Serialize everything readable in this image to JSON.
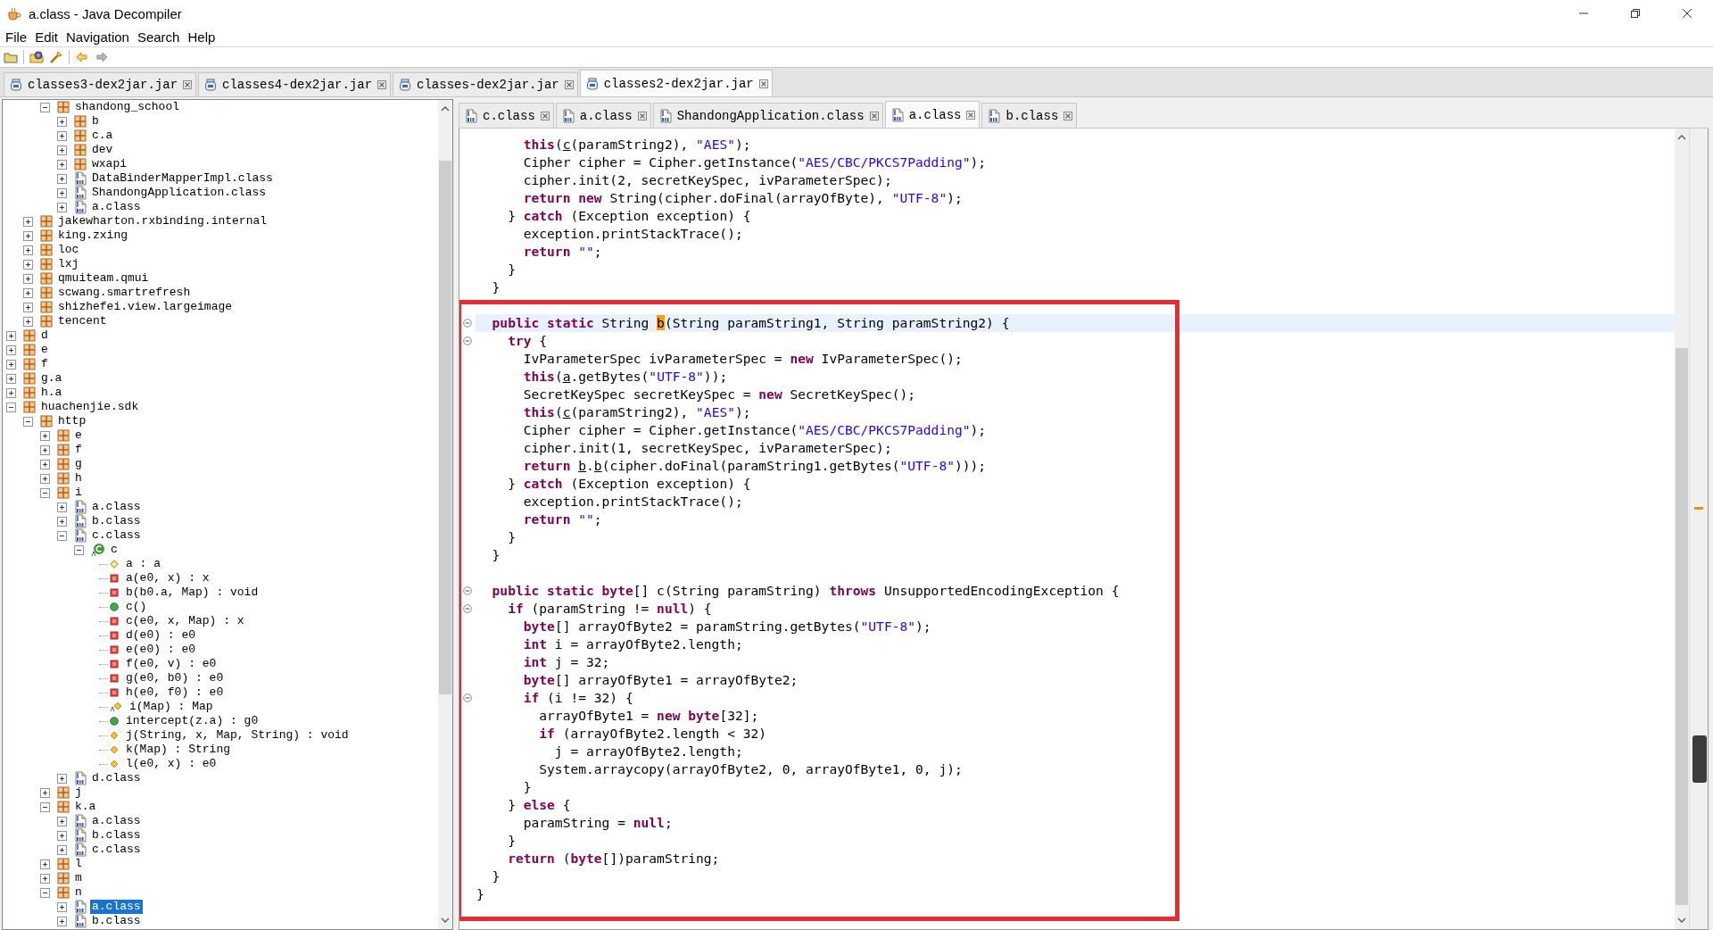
{
  "window": {
    "title": "a.class - Java Decompiler"
  },
  "menu": [
    "File",
    "Edit",
    "Navigation",
    "Search",
    "Help"
  ],
  "toolbar": {
    "back": {
      "disabled": false
    },
    "forward": {
      "disabled": true
    }
  },
  "jar_tabs": [
    {
      "label": "classes3-dex2jar.jar",
      "selected": false
    },
    {
      "label": "classes4-dex2jar.jar",
      "selected": false
    },
    {
      "label": "classes-dex2jar.jar",
      "selected": false
    },
    {
      "label": "classes2-dex2jar.jar",
      "selected": true
    }
  ],
  "tree": {
    "items": [
      {
        "children": [
          {
            "children": [
              {
                "label": "shandong_school",
                "kind": "package",
                "expanded": true,
                "selected": false,
                "children": [
                  {
                    "label": "b",
                    "kind": "package",
                    "expanded": false,
                    "selected": false
                  },
                  {
                    "label": "c.a",
                    "kind": "package",
                    "expanded": false,
                    "selected": false
                  },
                  {
                    "label": "dev",
                    "kind": "package",
                    "expanded": false,
                    "selected": false
                  },
                  {
                    "label": "wxapi",
                    "kind": "package",
                    "expanded": false,
                    "selected": false
                  },
                  {
                    "label": "DataBinderMapperImpl.class",
                    "kind": "classfile",
                    "expanded": false,
                    "selected": false
                  },
                  {
                    "label": "ShandongApplication.class",
                    "kind": "classfile",
                    "expanded": false,
                    "selected": false
                  },
                  {
                    "label": "a.class",
                    "kind": "classfile",
                    "expanded": false,
                    "selected": false
                  }
                ]
              }
            ]
          },
          {
            "label": "jakewharton.rxbinding.internal",
            "kind": "package",
            "expanded": false,
            "selected": false
          },
          {
            "label": "king.zxing",
            "kind": "package",
            "expanded": false,
            "selected": false
          },
          {
            "label": "loc",
            "kind": "package",
            "expanded": false,
            "selected": false
          },
          {
            "label": "lxj",
            "kind": "package",
            "expanded": false,
            "selected": false
          },
          {
            "label": "qmuiteam.qmui",
            "kind": "package",
            "expanded": false,
            "selected": false
          },
          {
            "label": "scwang.smartrefresh",
            "kind": "package",
            "expanded": false,
            "selected": false
          },
          {
            "label": "shizhefei.view.largeimage",
            "kind": "package",
            "expanded": false,
            "selected": false
          },
          {
            "label": "tencent",
            "kind": "package",
            "expanded": false,
            "selected": false
          }
        ]
      },
      {
        "label": "d",
        "kind": "package",
        "expanded": false,
        "selected": false
      },
      {
        "label": "e",
        "kind": "package",
        "expanded": false,
        "selected": false
      },
      {
        "label": "f",
        "kind": "package",
        "expanded": false,
        "selected": false
      },
      {
        "label": "g.a",
        "kind": "package",
        "expanded": false,
        "selected": false
      },
      {
        "label": "h.a",
        "kind": "package",
        "expanded": false,
        "selected": false
      },
      {
        "label": "huachenjie.sdk",
        "kind": "package",
        "expanded": true,
        "selected": false,
        "children": [
          {
            "label": "http",
            "kind": "package",
            "expanded": true,
            "selected": false,
            "children": [
              {
                "label": "e",
                "kind": "package",
                "expanded": false,
                "selected": false
              },
              {
                "label": "f",
                "kind": "package",
                "expanded": false,
                "selected": false
              },
              {
                "label": "g",
                "kind": "package",
                "expanded": false,
                "selected": false
              },
              {
                "label": "h",
                "kind": "package",
                "expanded": false,
                "selected": false
              },
              {
                "label": "i",
                "kind": "package",
                "expanded": true,
                "selected": false,
                "children": [
                  {
                    "label": "a.class",
                    "kind": "classfile",
                    "expanded": false,
                    "selected": false
                  },
                  {
                    "label": "b.class",
                    "kind": "classfile",
                    "expanded": false,
                    "selected": false
                  },
                  {
                    "label": "c.class",
                    "kind": "classfile",
                    "expanded": true,
                    "selected": false,
                    "children": [
                      {
                        "label": "c",
                        "kind": "class",
                        "expanded": true,
                        "selected": false,
                        "children": [
                          {
                            "label": "a : a",
                            "kind": "field",
                            "selected": false
                          },
                          {
                            "label": "a(e0, x) : x",
                            "kind": "private",
                            "selected": false
                          },
                          {
                            "label": "b(b0.a, Map) : void",
                            "kind": "private",
                            "selected": false
                          },
                          {
                            "label": "c()",
                            "kind": "public",
                            "selected": false
                          },
                          {
                            "label": "c(e0, x, Map) : x",
                            "kind": "private",
                            "selected": false
                          },
                          {
                            "label": "d(e0) : e0",
                            "kind": "private",
                            "selected": false
                          },
                          {
                            "label": "e(e0) : e0",
                            "kind": "private",
                            "selected": false
                          },
                          {
                            "label": "f(e0, v) : e0",
                            "kind": "private",
                            "selected": false
                          },
                          {
                            "label": "g(e0, b0) : e0",
                            "kind": "private",
                            "selected": false
                          },
                          {
                            "label": "h(e0, f0) : e0",
                            "kind": "private",
                            "selected": false
                          },
                          {
                            "label": "i(Map) : Map",
                            "kind": "abstract",
                            "selected": false
                          },
                          {
                            "label": "intercept(z.a) : g0",
                            "kind": "public",
                            "selected": false
                          },
                          {
                            "label": "j(String, x, Map, String) : void",
                            "kind": "default",
                            "selected": false
                          },
                          {
                            "label": "k(Map) : String",
                            "kind": "default",
                            "selected": false
                          },
                          {
                            "label": "l(e0, x) : e0",
                            "kind": "default",
                            "selected": false
                          }
                        ]
                      }
                    ]
                  },
                  {
                    "label": "d.class",
                    "kind": "classfile",
                    "expanded": false,
                    "selected": false
                  }
                ]
              },
              {
                "label": "j",
                "kind": "package",
                "expanded": false,
                "selected": false
              },
              {
                "label": "k.a",
                "kind": "package",
                "expanded": true,
                "selected": false,
                "children": [
                  {
                    "label": "a.class",
                    "kind": "classfile",
                    "expanded": false,
                    "selected": false
                  },
                  {
                    "label": "b.class",
                    "kind": "classfile",
                    "expanded": false,
                    "selected": false
                  },
                  {
                    "label": "c.class",
                    "kind": "classfile",
                    "expanded": false,
                    "selected": false
                  }
                ]
              },
              {
                "label": "l",
                "kind": "package",
                "expanded": false,
                "selected": false
              },
              {
                "label": "m",
                "kind": "package",
                "expanded": false,
                "selected": false
              },
              {
                "label": "n",
                "kind": "package",
                "expanded": true,
                "selected": false,
                "children": [
                  {
                    "label": "a.class",
                    "kind": "classfile",
                    "expanded": false,
                    "selected": true
                  },
                  {
                    "label": "b.class",
                    "kind": "classfile",
                    "expanded": false,
                    "selected": false
                  }
                ]
              }
            ]
          }
        ]
      }
    ]
  },
  "class_tabs": [
    {
      "label": "c.class",
      "selected": false
    },
    {
      "label": "a.class",
      "selected": false
    },
    {
      "label": "ShandongApplication.class",
      "selected": false
    },
    {
      "label": "a.class",
      "selected": true
    },
    {
      "label": "b.class",
      "selected": false
    }
  ],
  "code": {
    "blocks": [
      {
        "framed": false,
        "lines": [
          {
            "kind": "plain",
            "current": false,
            "tokens": [
              {
                "kind": "kw",
                "text": "      this"
              },
              {
                "kind": "p",
                "text": "("
              },
              {
                "kind": "u",
                "text": "c"
              },
              {
                "kind": "p",
                "text": "(paramString2), "
              },
              {
                "kind": "str",
                "text": "\"AES\""
              },
              {
                "kind": "p",
                "text": ");"
              }
            ]
          },
          {
            "kind": "plain",
            "current": false,
            "tokens": [
              {
                "kind": "p",
                "text": "      Cipher cipher = Cipher.getInstance("
              },
              {
                "kind": "str",
                "text": "\"AES/CBC/PKCS7Padding\""
              },
              {
                "kind": "p",
                "text": ");"
              }
            ]
          },
          {
            "kind": "plain",
            "current": false,
            "tokens": [
              {
                "kind": "p",
                "text": "      cipher.init(2, secretKeySpec, ivParameterSpec);"
              }
            ]
          },
          {
            "kind": "plain",
            "current": false,
            "tokens": [
              {
                "kind": "kw",
                "text": "      return new"
              },
              {
                "kind": "p",
                "text": " String(cipher.doFinal(arrayOfByte), "
              },
              {
                "kind": "str",
                "text": "\"UTF-8\""
              },
              {
                "kind": "p",
                "text": ");"
              }
            ]
          },
          {
            "kind": "plain",
            "current": false,
            "tokens": [
              {
                "kind": "p",
                "text": "    } "
              },
              {
                "kind": "kw",
                "text": "catch"
              },
              {
                "kind": "p",
                "text": " (Exception exception) {"
              }
            ]
          },
          {
            "kind": "plain",
            "current": false,
            "tokens": [
              {
                "kind": "p",
                "text": "      exception.printStackTrace();"
              }
            ]
          },
          {
            "kind": "plain",
            "current": false,
            "tokens": [
              {
                "kind": "kw",
                "text": "      return"
              },
              {
                "kind": "str",
                "text": " \"\""
              },
              {
                "kind": "p",
                "text": ";"
              }
            ]
          },
          {
            "kind": "plain",
            "current": false,
            "tokens": [
              {
                "kind": "p",
                "text": "    }"
              }
            ]
          },
          {
            "kind": "plain",
            "current": false,
            "tokens": [
              {
                "kind": "p",
                "text": "  }"
              }
            ]
          }
        ]
      },
      {
        "framed": true,
        "lines": [
          {
            "kind": "blank",
            "current": false
          },
          {
            "kind": "fold",
            "current": true,
            "tokens": [
              {
                "kind": "kw",
                "text": "  public static"
              },
              {
                "kind": "p",
                "text": " String "
              },
              {
                "kind": "mark",
                "text": "b"
              },
              {
                "kind": "p",
                "text": "(String paramString1, String paramString2) {"
              }
            ]
          },
          {
            "kind": "fold",
            "current": false,
            "tokens": [
              {
                "kind": "kw",
                "text": "    try"
              },
              {
                "kind": "p",
                "text": " {"
              }
            ]
          },
          {
            "kind": "plain",
            "current": false,
            "tokens": [
              {
                "kind": "p",
                "text": "      IvParameterSpec ivParameterSpec = "
              },
              {
                "kind": "kw",
                "text": "new"
              },
              {
                "kind": "p",
                "text": " IvParameterSpec();"
              }
            ]
          },
          {
            "kind": "plain",
            "current": false,
            "tokens": [
              {
                "kind": "kw",
                "text": "      this"
              },
              {
                "kind": "p",
                "text": "("
              },
              {
                "kind": "u",
                "text": "a"
              },
              {
                "kind": "p",
                "text": ".getBytes("
              },
              {
                "kind": "str",
                "text": "\"UTF-8\""
              },
              {
                "kind": "p",
                "text": "));"
              }
            ]
          },
          {
            "kind": "plain",
            "current": false,
            "tokens": [
              {
                "kind": "p",
                "text": "      SecretKeySpec secretKeySpec = "
              },
              {
                "kind": "kw",
                "text": "new"
              },
              {
                "kind": "p",
                "text": " SecretKeySpec();"
              }
            ]
          },
          {
            "kind": "plain",
            "current": false,
            "tokens": [
              {
                "kind": "kw",
                "text": "      this"
              },
              {
                "kind": "p",
                "text": "("
              },
              {
                "kind": "u",
                "text": "c"
              },
              {
                "kind": "p",
                "text": "(paramString2), "
              },
              {
                "kind": "str",
                "text": "\"AES\""
              },
              {
                "kind": "p",
                "text": ");"
              }
            ]
          },
          {
            "kind": "plain",
            "current": false,
            "tokens": [
              {
                "kind": "p",
                "text": "      Cipher cipher = Cipher.getInstance("
              },
              {
                "kind": "str",
                "text": "\"AES/CBC/PKCS7Padding\""
              },
              {
                "kind": "p",
                "text": ");"
              }
            ]
          },
          {
            "kind": "plain",
            "current": false,
            "tokens": [
              {
                "kind": "p",
                "text": "      cipher.init(1, secretKeySpec, ivParameterSpec);"
              }
            ]
          },
          {
            "kind": "plain",
            "current": false,
            "tokens": [
              {
                "kind": "kw",
                "text": "      return "
              },
              {
                "kind": "u",
                "text": "b"
              },
              {
                "kind": "p",
                "text": "."
              },
              {
                "kind": "u",
                "text": "b"
              },
              {
                "kind": "p",
                "text": "(cipher.doFinal(paramString1.getBytes("
              },
              {
                "kind": "str",
                "text": "\"UTF-8\""
              },
              {
                "kind": "p",
                "text": ")));"
              }
            ]
          },
          {
            "kind": "plain",
            "current": false,
            "tokens": [
              {
                "kind": "p",
                "text": "    } "
              },
              {
                "kind": "kw",
                "text": "catch"
              },
              {
                "kind": "p",
                "text": " (Exception exception) {"
              }
            ]
          },
          {
            "kind": "plain",
            "current": false,
            "tokens": [
              {
                "kind": "p",
                "text": "      exception.printStackTrace();"
              }
            ]
          },
          {
            "kind": "plain",
            "current": false,
            "tokens": [
              {
                "kind": "kw",
                "text": "      return"
              },
              {
                "kind": "str",
                "text": " \"\""
              },
              {
                "kind": "p",
                "text": ";"
              }
            ]
          },
          {
            "kind": "plain",
            "current": false,
            "tokens": [
              {
                "kind": "p",
                "text": "    }"
              }
            ]
          },
          {
            "kind": "plain",
            "current": false,
            "tokens": [
              {
                "kind": "p",
                "text": "  }"
              }
            ]
          },
          {
            "kind": "blank",
            "current": false
          },
          {
            "kind": "fold",
            "current": false,
            "tokens": [
              {
                "kind": "kw",
                "text": "  public static byte"
              },
              {
                "kind": "p",
                "text": "[] c(String paramString) "
              },
              {
                "kind": "kw",
                "text": "throws"
              },
              {
                "kind": "p",
                "text": " UnsupportedEncodingException {"
              }
            ]
          },
          {
            "kind": "fold",
            "current": false,
            "tokens": [
              {
                "kind": "kw",
                "text": "    if"
              },
              {
                "kind": "p",
                "text": " (paramString != "
              },
              {
                "kind": "kw",
                "text": "null"
              },
              {
                "kind": "p",
                "text": ") {"
              }
            ]
          },
          {
            "kind": "plain",
            "current": false,
            "tokens": [
              {
                "kind": "kw",
                "text": "      byte"
              },
              {
                "kind": "p",
                "text": "[] arrayOfByte2 = paramString.getBytes("
              },
              {
                "kind": "str",
                "text": "\"UTF-8\""
              },
              {
                "kind": "p",
                "text": ");"
              }
            ]
          },
          {
            "kind": "plain",
            "current": false,
            "tokens": [
              {
                "kind": "kw",
                "text": "      int"
              },
              {
                "kind": "p",
                "text": " i = arrayOfByte2.length;"
              }
            ]
          },
          {
            "kind": "plain",
            "current": false,
            "tokens": [
              {
                "kind": "kw",
                "text": "      int"
              },
              {
                "kind": "p",
                "text": " j = 32;"
              }
            ]
          },
          {
            "kind": "plain",
            "current": false,
            "tokens": [
              {
                "kind": "kw",
                "text": "      byte"
              },
              {
                "kind": "p",
                "text": "[] arrayOfByte1 = arrayOfByte2;"
              }
            ]
          },
          {
            "kind": "fold",
            "current": false,
            "tokens": [
              {
                "kind": "kw",
                "text": "      if"
              },
              {
                "kind": "p",
                "text": " (i != 32) {"
              }
            ]
          },
          {
            "kind": "plain",
            "current": false,
            "tokens": [
              {
                "kind": "p",
                "text": "        arrayOfByte1 = "
              },
              {
                "kind": "kw",
                "text": "new byte"
              },
              {
                "kind": "p",
                "text": "[32];"
              }
            ]
          },
          {
            "kind": "plain",
            "current": false,
            "tokens": [
              {
                "kind": "kw",
                "text": "        if"
              },
              {
                "kind": "p",
                "text": " (arrayOfByte2.length < 32)"
              }
            ]
          },
          {
            "kind": "plain",
            "current": false,
            "tokens": [
              {
                "kind": "p",
                "text": "          j = arrayOfByte2.length;"
              }
            ]
          },
          {
            "kind": "plain",
            "current": false,
            "tokens": [
              {
                "kind": "p",
                "text": "        System.arraycopy(arrayOfByte2, 0, arrayOfByte1, 0, j);"
              }
            ]
          },
          {
            "kind": "plain",
            "current": false,
            "tokens": [
              {
                "kind": "p",
                "text": "      }"
              }
            ]
          },
          {
            "kind": "plain",
            "current": false,
            "tokens": [
              {
                "kind": "p",
                "text": "    } "
              },
              {
                "kind": "kw",
                "text": "else"
              },
              {
                "kind": "p",
                "text": " {"
              }
            ]
          },
          {
            "kind": "plain",
            "current": false,
            "tokens": [
              {
                "kind": "p",
                "text": "      paramString = "
              },
              {
                "kind": "kw",
                "text": "null"
              },
              {
                "kind": "p",
                "text": ";"
              }
            ]
          },
          {
            "kind": "plain",
            "current": false,
            "tokens": [
              {
                "kind": "p",
                "text": "    }"
              }
            ]
          },
          {
            "kind": "plain",
            "current": false,
            "tokens": [
              {
                "kind": "kw",
                "text": "    return"
              },
              {
                "kind": "p",
                "text": " ("
              },
              {
                "kind": "kw",
                "text": "byte"
              },
              {
                "kind": "p",
                "text": "[])paramString;"
              }
            ]
          },
          {
            "kind": "plain",
            "current": false,
            "tokens": [
              {
                "kind": "p",
                "text": "  }"
              }
            ]
          },
          {
            "kind": "plain",
            "current": false,
            "tokens": [
              {
                "kind": "p",
                "text": "}"
              }
            ]
          }
        ]
      }
    ]
  }
}
